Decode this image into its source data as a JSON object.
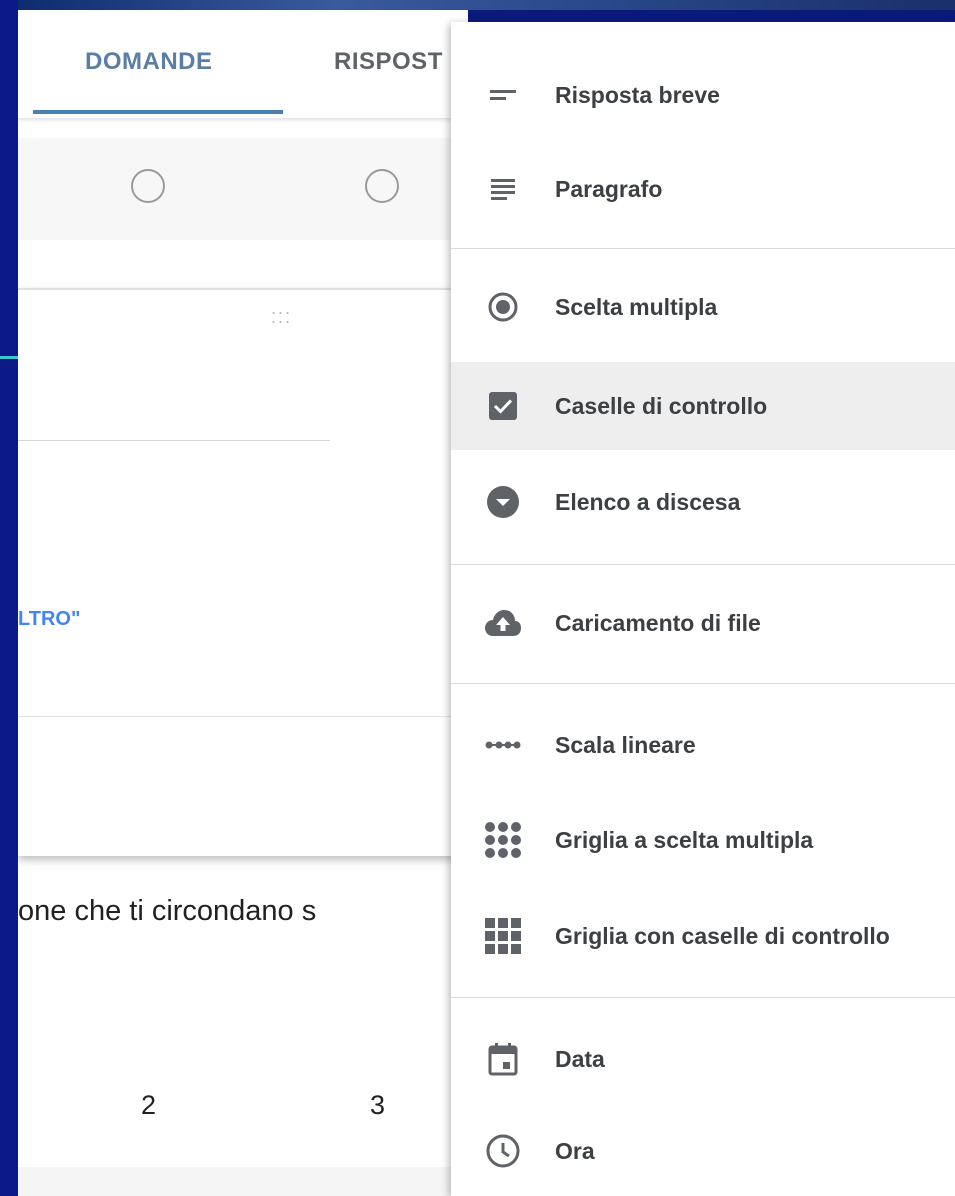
{
  "tabs": {
    "questions": "DOMANDE",
    "responses": "RISPOST"
  },
  "card": {
    "other_option_link": "LTRO\""
  },
  "question": {
    "text_fragment": "one che ti circondano s"
  },
  "scale": {
    "labels": [
      "2",
      "3"
    ]
  },
  "menu": {
    "items": [
      {
        "label": "Risposta breve",
        "icon": "short-text-icon"
      },
      {
        "label": "Paragrafo",
        "icon": "paragraph-icon"
      },
      {
        "label": "Scelta multipla",
        "icon": "radio-button-icon"
      },
      {
        "label": "Caselle di controllo",
        "icon": "checkbox-icon",
        "highlighted": true
      },
      {
        "label": "Elenco a discesa",
        "icon": "dropdown-icon"
      },
      {
        "label": "Caricamento di file",
        "icon": "cloud-upload-icon"
      },
      {
        "label": "Scala lineare",
        "icon": "linear-scale-icon"
      },
      {
        "label": "Griglia a scelta multipla",
        "icon": "multiple-choice-grid-icon"
      },
      {
        "label": "Griglia con caselle di controllo",
        "icon": "checkbox-grid-icon"
      },
      {
        "label": "Data",
        "icon": "calendar-icon"
      },
      {
        "label": "Ora",
        "icon": "clock-icon"
      }
    ]
  },
  "colors": {
    "background": "#0a1a7a",
    "tab_active": "#5b7ea4",
    "link_blue": "#4285f4",
    "icon_grey": "#5f6368",
    "highlight": "#eeeeee"
  }
}
